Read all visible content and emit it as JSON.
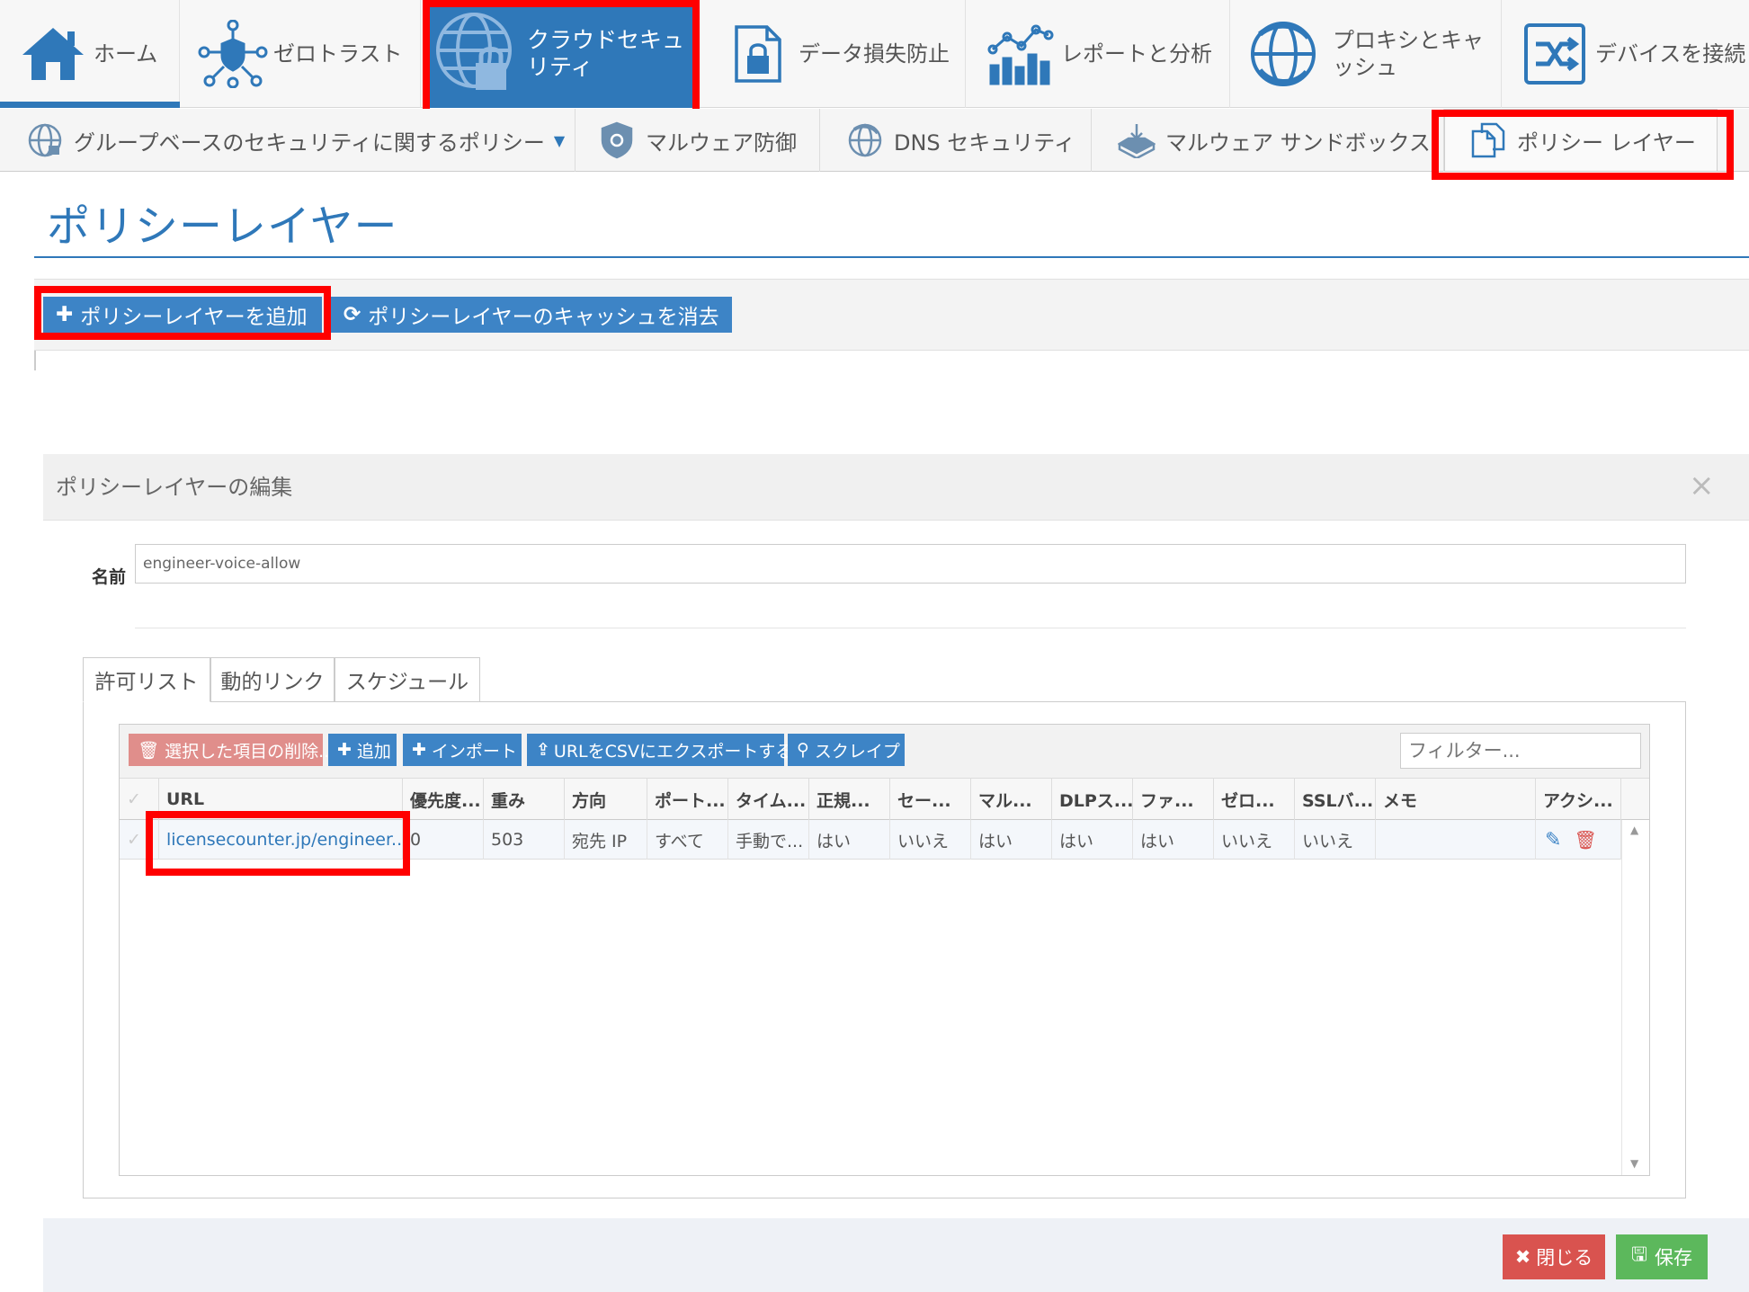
{
  "topnav": {
    "home": "ホーム",
    "zero_trust": "ゼロトラスト",
    "cloud_security": "クラウドセキュ\nリティ",
    "dlp": "データ損失防止",
    "reports": "レポートと分析",
    "proxy": "プロキシとキャ\nッシュ",
    "devices": "デバイスを接続"
  },
  "subnav": {
    "group_policy": "グループベースのセキュリティに関するポリシー",
    "malware": "マルウェア防御",
    "dns": "DNS セキュリティ",
    "sandbox": "マルウェア サンドボックス",
    "policy_layer": "ポリシー レイヤー"
  },
  "page": {
    "title": "ポリシーレイヤー",
    "add_button": "ポリシーレイヤーを追加",
    "clear_cache_button": "ポリシーレイヤーのキャッシュを消去"
  },
  "modal": {
    "title": "ポリシーレイヤーの編集",
    "close": "×",
    "name_label": "名前",
    "name_value": "engineer-voice-allow",
    "tabs": [
      "許可リスト",
      "動的リンク",
      "スケジュール"
    ],
    "toolbar": {
      "delete_selected": "選択した項目の削除...",
      "add": "追加",
      "import": "インポート",
      "export_csv": "URLをCSVにエクスポートする",
      "scrape": "スクレイプ",
      "filter_placeholder": "フィルター..."
    },
    "columns": [
      "URL",
      "優先度...",
      "重み",
      "方向",
      "ポート...",
      "タイム...",
      "正規...",
      "セー...",
      "マル...",
      "DLPス...",
      "ファ...",
      "ゼロ...",
      "SSLバ...",
      "メモ",
      "アクシ..."
    ],
    "rows": [
      [
        "licensecounter.jp/engineer...",
        "0",
        "503",
        "宛先 IP",
        "すべて",
        "手動で...",
        "はい",
        "いいえ",
        "はい",
        "はい",
        "はい",
        "いいえ",
        "いいえ",
        ""
      ]
    ],
    "close_button": "閉じる",
    "save_button": "保存"
  },
  "colors": {
    "accent": "#2f78b9",
    "button_blue": "#3d84c6",
    "danger": "#d9534f",
    "danger_muted": "#e08e8b",
    "success": "#5cb85c",
    "highlight": "#ff0000"
  }
}
